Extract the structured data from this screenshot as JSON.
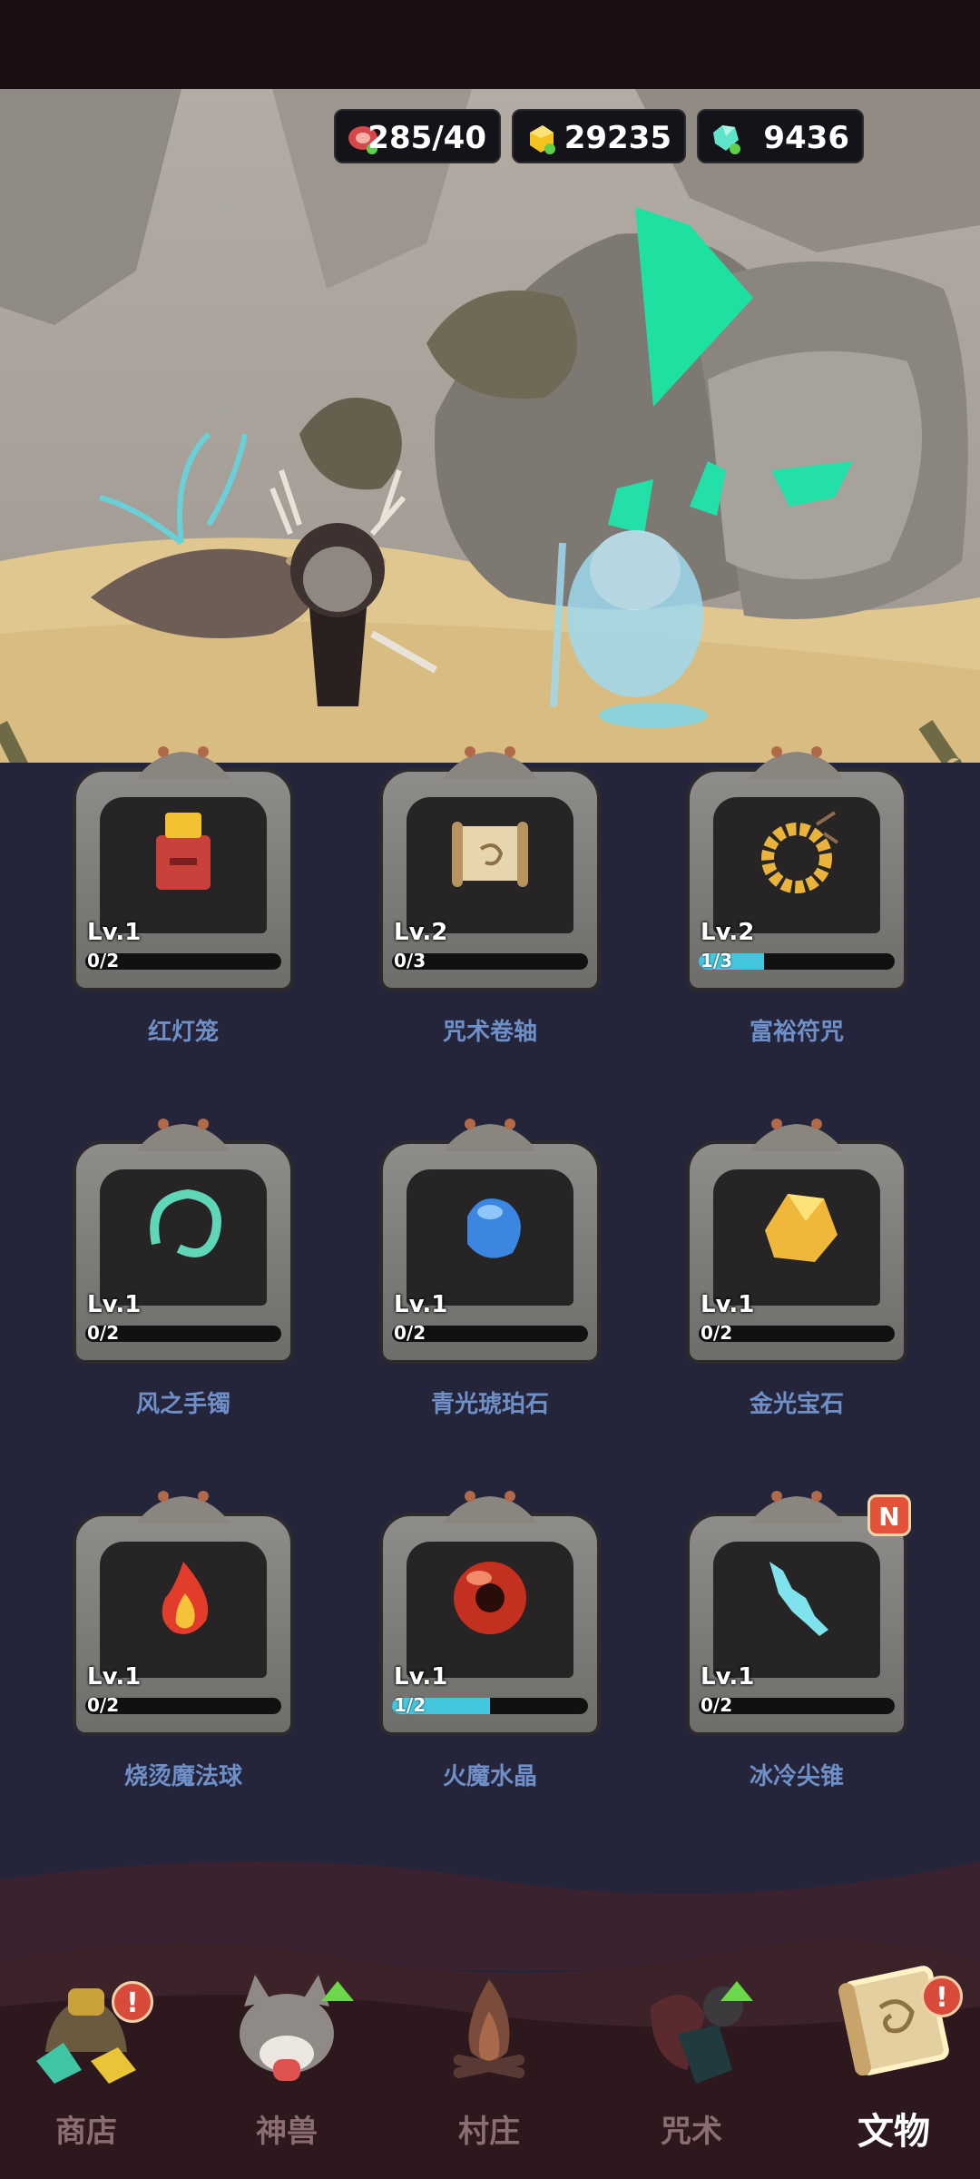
{
  "resources": {
    "meat": "285/40",
    "gold": "29235",
    "gem": "9436"
  },
  "artifacts": [
    {
      "name": "红灯笼",
      "level": "1",
      "progress": "0/2",
      "fill": 0,
      "icon": "red-lantern-icon",
      "badge": ""
    },
    {
      "name": "咒术卷轴",
      "level": "2",
      "progress": "0/3",
      "fill": 0,
      "icon": "spell-scroll-icon",
      "badge": ""
    },
    {
      "name": "富裕符咒",
      "level": "2",
      "progress": "1/3",
      "fill": 0.333,
      "icon": "wealth-charm-icon",
      "badge": ""
    },
    {
      "name": "风之手镯",
      "level": "1",
      "progress": "0/2",
      "fill": 0,
      "icon": "wind-bracelet-icon",
      "badge": ""
    },
    {
      "name": "青光琥珀石",
      "level": "1",
      "progress": "0/2",
      "fill": 0,
      "icon": "blue-amber-icon",
      "badge": ""
    },
    {
      "name": "金光宝石",
      "level": "1",
      "progress": "0/2",
      "fill": 0,
      "icon": "gold-gem-icon",
      "badge": ""
    },
    {
      "name": "烧烫魔法球",
      "level": "1",
      "progress": "0/2",
      "fill": 0,
      "icon": "fireball-icon",
      "badge": ""
    },
    {
      "name": "火魔水晶",
      "level": "1",
      "progress": "1/2",
      "fill": 0.5,
      "icon": "fire-crystal-icon",
      "badge": ""
    },
    {
      "name": "冰冷尖锥",
      "level": "1",
      "progress": "0/2",
      "fill": 0,
      "icon": "ice-spike-icon",
      "badge": "N"
    }
  ],
  "lv_prefix": "Lv.",
  "nav": {
    "shop": "商店",
    "beast": "神兽",
    "village": "村庄",
    "spell": "咒术",
    "relic": "文物"
  },
  "alerts": {
    "shop": "!",
    "relic": "!"
  },
  "colors": {
    "accent_blue": "#44c7de",
    "name_blue": "#6f8fc7",
    "badge_red": "#e2533a",
    "panel": "#24243b"
  }
}
